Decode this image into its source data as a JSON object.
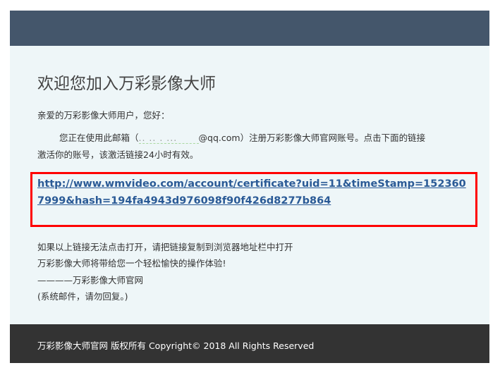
{
  "title": "欢迎您加入万彩影像大师",
  "greeting": "亲爱的万彩影像大师用户，您好：",
  "body_prefix": "您正在使用此邮箱（",
  "email_masked": ".. .. . ...",
  "email_domain": "@qq.com",
  "body_suffix": "）注册万彩影像大师官网账号。点击下面的链接",
  "body_line2": "激活你的账号，该激活链接24小时有效。",
  "activation_link": "http://www.wmvideo.com/account/certificate?uid=11&timeStamp=1523607999&hash=194fa4943d976098f90f426d8277b864",
  "notes": [
    "如果以上链接无法点击打开，请把链接复制到浏览器地址栏中打开",
    "万彩影像大师将带给您一个轻松愉快的操作体验!",
    "————万彩影像大师官网",
    "(系统邮件，请勿回复。)"
  ],
  "footer": "万彩影像大师官网 版权所有 Copyright© 2018 All Rights Reserved"
}
